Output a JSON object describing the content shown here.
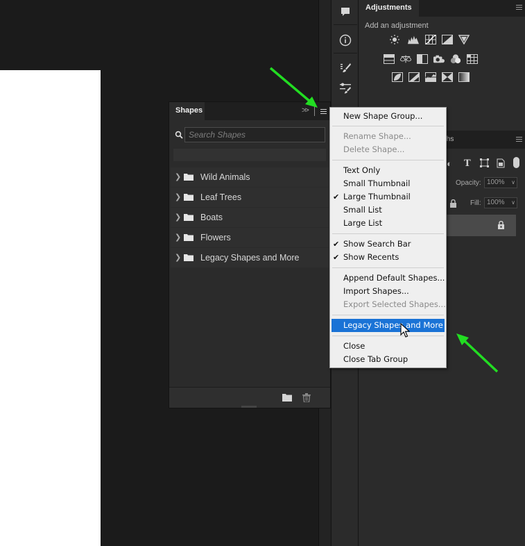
{
  "shapes_panel": {
    "tab_label": "Shapes",
    "search_placeholder": "Search Shapes",
    "groups": [
      {
        "label": "Wild Animals"
      },
      {
        "label": "Leaf Trees"
      },
      {
        "label": "Boats"
      },
      {
        "label": "Flowers"
      },
      {
        "label": "Legacy Shapes and More"
      }
    ]
  },
  "adjustments_panel": {
    "tab_label": "Adjustments",
    "heading": "Add an adjustment"
  },
  "layers_panel": {
    "tab_fragment": "ths",
    "opacity_label": "Opacity:",
    "opacity_value": "100%",
    "fill_label": "Fill:",
    "fill_value": "100%"
  },
  "flyout_menu": {
    "items": [
      {
        "label": "New Shape Group...",
        "state": "enabled",
        "checked": false
      },
      {
        "label": "Rename Shape...",
        "state": "disabled",
        "checked": false
      },
      {
        "label": "Delete Shape...",
        "state": "disabled",
        "checked": false
      },
      {
        "label": "Text Only",
        "state": "enabled",
        "checked": false
      },
      {
        "label": "Small Thumbnail",
        "state": "enabled",
        "checked": false
      },
      {
        "label": "Large Thumbnail",
        "state": "enabled",
        "checked": true
      },
      {
        "label": "Small List",
        "state": "enabled",
        "checked": false
      },
      {
        "label": "Large List",
        "state": "enabled",
        "checked": false
      },
      {
        "label": "Show Search Bar",
        "state": "enabled",
        "checked": true
      },
      {
        "label": "Show Recents",
        "state": "enabled",
        "checked": true
      },
      {
        "label": "Append Default Shapes...",
        "state": "enabled",
        "checked": false
      },
      {
        "label": "Import Shapes...",
        "state": "enabled",
        "checked": false
      },
      {
        "label": "Export Selected Shapes...",
        "state": "disabled",
        "checked": false
      },
      {
        "label": "Legacy Shapes and More",
        "state": "highlighted",
        "checked": false
      },
      {
        "label": "Close",
        "state": "enabled",
        "checked": false
      },
      {
        "label": "Close Tab Group",
        "state": "enabled",
        "checked": false
      }
    ],
    "check_glyph": "✔"
  },
  "icons": {
    "strip": [
      "comment-icon",
      "info-icon",
      "brushes-icon",
      "brush-settings-icon"
    ],
    "annotation_color": "#22dd22",
    "highlight_color": "#1a73d6"
  }
}
